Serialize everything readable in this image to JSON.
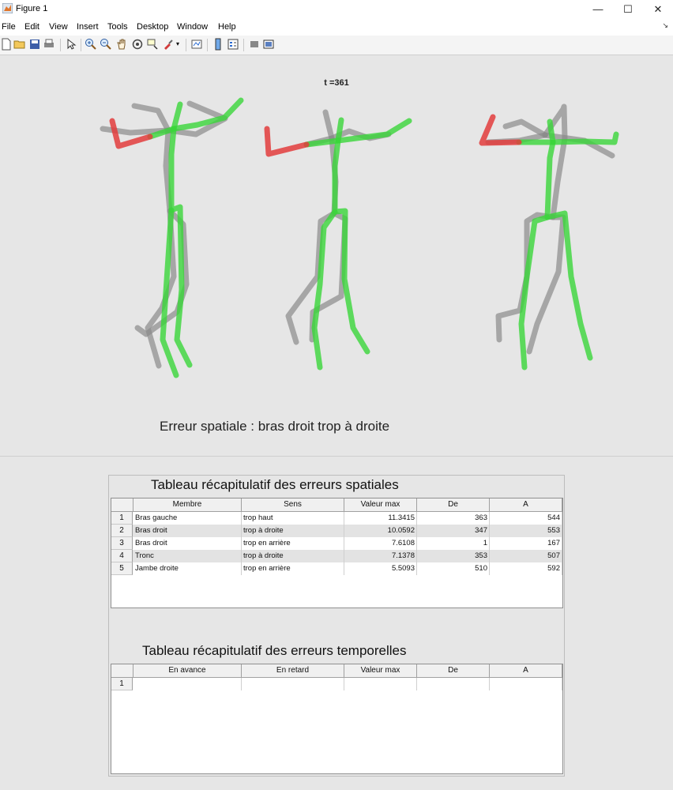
{
  "window": {
    "title": "Figure 1",
    "minimize": "—",
    "maximize": "☐",
    "close": "✕"
  },
  "menu": [
    "File",
    "Edit",
    "View",
    "Insert",
    "Tools",
    "Desktop",
    "Window",
    "Help"
  ],
  "toolbar": {
    "icons": [
      "new-figure-icon",
      "open-file-icon",
      "save-icon",
      "print-icon",
      "pointer-icon",
      "zoom-in-icon",
      "zoom-out-icon",
      "pan-icon",
      "rotate-3d-icon",
      "data-cursor-icon",
      "brush-icon",
      "dropdown-arrow-icon",
      "link-plot-icon",
      "colorbar-icon",
      "legend-icon",
      "hide-plot-tools-icon",
      "show-plot-tools-icon"
    ]
  },
  "figure": {
    "title": "t =361",
    "message": "Erreur spatiale :  bras droit trop à droite",
    "colors": {
      "reference": "#8a8a8a",
      "correct": "#39d639",
      "error": "#e23c3c",
      "background": "#e6e6e6"
    }
  },
  "spatial_table": {
    "title": "Tableau récapitulatif des erreurs spatiales",
    "columns": [
      "Membre",
      "Sens",
      "Valeur max",
      "De",
      "A"
    ],
    "rows": [
      {
        "num": "1",
        "membre": "Bras gauche",
        "sens": "trop haut",
        "valeur": "11.3415",
        "de": "363",
        "a": "544"
      },
      {
        "num": "2",
        "membre": "Bras droit",
        "sens": "trop à droite",
        "valeur": "10.0592",
        "de": "347",
        "a": "553"
      },
      {
        "num": "3",
        "membre": "Bras droit",
        "sens": "trop en arrière",
        "valeur": "7.6108",
        "de": "1",
        "a": "167"
      },
      {
        "num": "4",
        "membre": "Tronc",
        "sens": "trop à droite",
        "valeur": "7.1378",
        "de": "353",
        "a": "507"
      },
      {
        "num": "5",
        "membre": "Jambe droite",
        "sens": "trop en arrière",
        "valeur": "5.5093",
        "de": "510",
        "a": "592"
      }
    ]
  },
  "temporal_table": {
    "title": "Tableau récapitulatif des erreurs temporelles",
    "columns": [
      "En avance",
      "En retard",
      "Valeur max",
      "De",
      "A"
    ],
    "rows": [
      {
        "num": "1",
        "avance": "",
        "retard": "",
        "valeur": "",
        "de": "",
        "a": ""
      }
    ]
  }
}
